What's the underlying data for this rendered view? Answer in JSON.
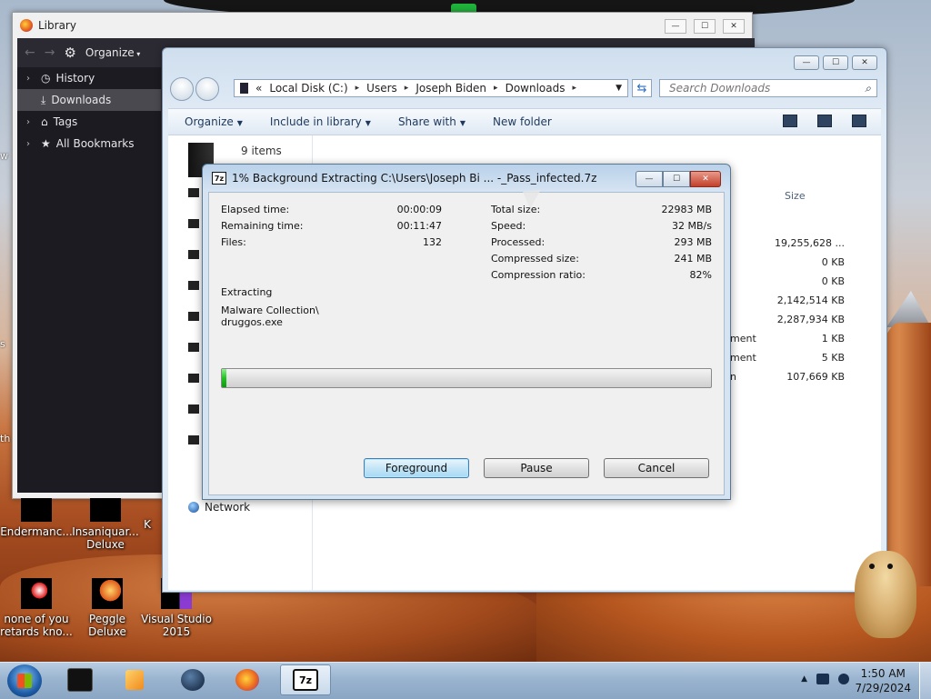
{
  "library": {
    "title": "Library",
    "organize": "Organize",
    "sidebar": [
      {
        "label": "History",
        "chevron": true,
        "icon": "history-icon",
        "selected": false
      },
      {
        "label": "Downloads",
        "chevron": false,
        "icon": "download-icon",
        "selected": true
      },
      {
        "label": "Tags",
        "chevron": true,
        "icon": "tag-icon",
        "selected": false
      },
      {
        "label": "All Bookmarks",
        "chevron": true,
        "icon": "star-icon",
        "selected": false
      }
    ]
  },
  "explorer": {
    "address": [
      "Local Disk (C:)",
      "Users",
      "Joseph Biden",
      "Downloads"
    ],
    "address_prefix": "«",
    "search_placeholder": "Search Downloads",
    "commands": [
      {
        "label": "Organize",
        "dropdown": true
      },
      {
        "label": "Include in library",
        "dropdown": true
      },
      {
        "label": "Share with",
        "dropdown": true
      },
      {
        "label": "New folder",
        "dropdown": false
      }
    ],
    "items_count": "9 items",
    "size_header": "Size",
    "sizes": [
      "19,255,628 ...",
      "0 KB",
      "0 KB",
      "2,142,514 KB",
      "2,287,934 KB",
      "1 KB",
      "5 KB",
      "107,669 KB"
    ],
    "type_fragments": [
      "ment",
      "ment",
      "n"
    ],
    "network": "Network"
  },
  "dialog": {
    "title": "1% Background Extracting C:\\Users\\Joseph Bi ... -_Pass_infected.7z",
    "icon_text": "7z",
    "left_stats": [
      {
        "label": "Elapsed time:",
        "value": "00:00:09"
      },
      {
        "label": "Remaining time:",
        "value": "00:11:47"
      },
      {
        "label": "Files:",
        "value": "132"
      }
    ],
    "right_stats": [
      {
        "label": "Total size:",
        "value": "22983 MB"
      },
      {
        "label": "Speed:",
        "value": "32 MB/s"
      },
      {
        "label": "Processed:",
        "value": "293 MB"
      },
      {
        "label": "Compressed size:",
        "value": "241 MB"
      },
      {
        "label": "Compression ratio:",
        "value": "82%"
      }
    ],
    "status": "Extracting",
    "path_line1": "Malware Collection\\",
    "path_line2": "druggos.exe",
    "progress_fraction": 0.01,
    "buttons": {
      "foreground": "Foreground",
      "pause": "Pause",
      "cancel": "Cancel"
    }
  },
  "desktop": {
    "left_edge": [
      "w",
      "s",
      "th"
    ],
    "icons_row1": [
      "Endermanc...",
      "Insaniquar... Deluxe",
      "K"
    ],
    "icons_row2": [
      {
        "label": "none of you retards kno...",
        "glyph": "red"
      },
      {
        "label": "Peggle Deluxe",
        "glyph": "org"
      },
      {
        "label": "Visual Studio 2015",
        "glyph": "vs"
      }
    ]
  },
  "taskbar": {
    "time": "1:50 AM",
    "date": "7/29/2024",
    "tray_arrow": "▲"
  }
}
